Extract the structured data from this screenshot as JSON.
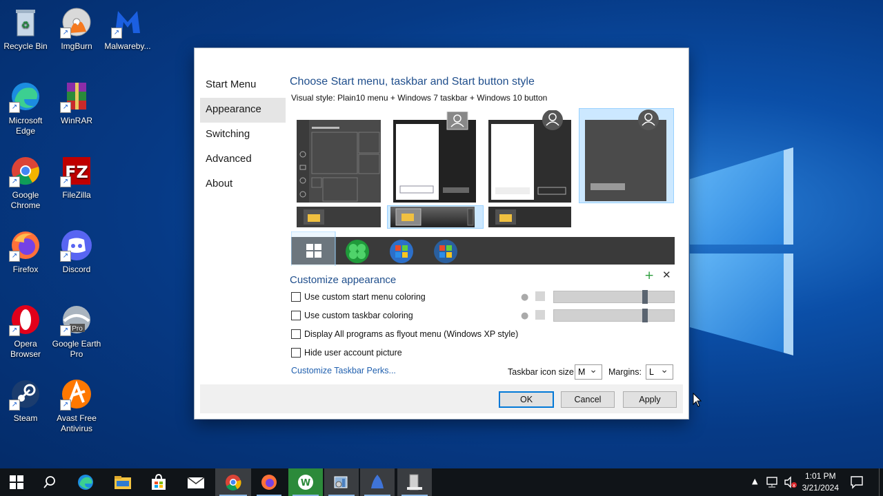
{
  "desktop": {
    "icons": [
      {
        "label": "Recycle Bin"
      },
      {
        "label": "ImgBurn"
      },
      {
        "label": "Malwareby..."
      },
      {
        "label": "Microsoft Edge"
      },
      {
        "label": "WinRAR"
      },
      {
        "label": "Google Chrome"
      },
      {
        "label": "FileZilla"
      },
      {
        "label": "Firefox"
      },
      {
        "label": "Discord"
      },
      {
        "label": "Opera Browser"
      },
      {
        "label": "Google Earth Pro"
      },
      {
        "label": "Steam"
      },
      {
        "label": "Avast Free Antivirus"
      }
    ]
  },
  "dialog": {
    "nav": [
      "Start Menu",
      "Appearance",
      "Switching",
      "Advanced",
      "About"
    ],
    "title": "Choose Start menu, taskbar and Start button style",
    "visual_style": "Visual style:  Plain10 menu + Windows 7 taskbar + Windows 10 button",
    "customize_title": "Customize appearance",
    "checkboxes": [
      "Use custom start menu coloring",
      "Use custom taskbar coloring",
      "Display All programs as flyout menu (Windows XP style)",
      "Hide user account picture"
    ],
    "link": "Customize Taskbar Perks...",
    "icon_size_label": "Taskbar icon size:",
    "icon_size_value": "M",
    "margins_label": "Margins:",
    "margins_value": "L",
    "ok": "OK",
    "cancel": "Cancel",
    "apply": "Apply",
    "colors": {
      "accent": "#1f4e8c",
      "selection": "#cce8ff"
    }
  },
  "taskbar": {
    "time": "1:01 PM",
    "date": "3/21/2024"
  }
}
